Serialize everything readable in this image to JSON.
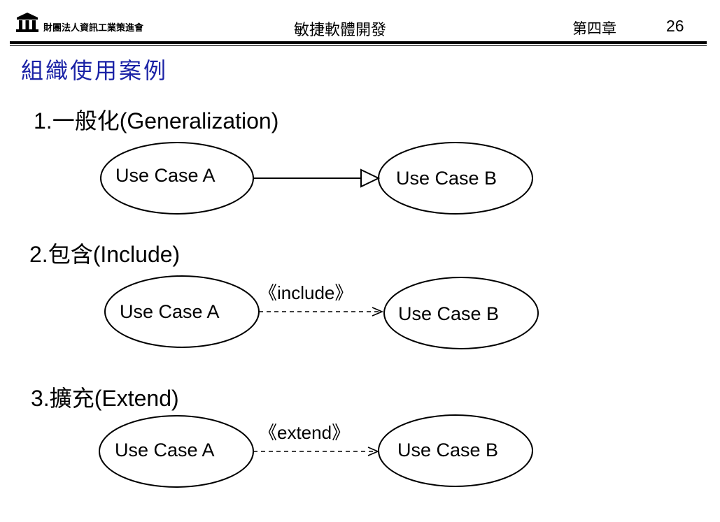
{
  "header": {
    "organization": "財團法人資訊工業策進會",
    "course_title": "敏捷軟體開發",
    "chapter": "第四章",
    "page_number": "26",
    "logo_icon": "institute-pillars-logo"
  },
  "page_title": "組織使用案例",
  "sections": [
    {
      "number": "1.",
      "label_cjk": "一般化",
      "label_latin": "(Generalization)",
      "source": "Use Case A",
      "target": "Use Case B",
      "relation": "generalization",
      "stereotype": ""
    },
    {
      "number": "2.",
      "label_cjk": "包含",
      "label_latin": "(Include)",
      "source": "Use Case A",
      "target": "Use Case B",
      "relation": "include",
      "stereotype": "《include》"
    },
    {
      "number": "3.",
      "label_cjk": "擴充",
      "label_latin": "(Extend)",
      "source": "Use Case A",
      "target": "Use Case B",
      "relation": "extend",
      "stereotype": "《extend》"
    }
  ],
  "colors": {
    "title": "#1a22a6",
    "text": "#000000",
    "background": "#ffffff"
  }
}
